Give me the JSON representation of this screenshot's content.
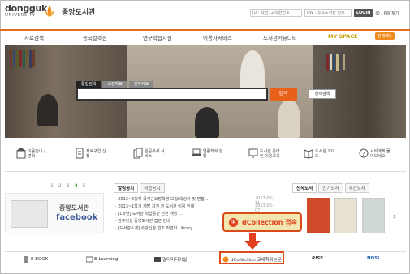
{
  "logo": {
    "name": "dongguk",
    "sub": "UNIVERSITY",
    "library": "중앙도서관"
  },
  "login": {
    "id_placeholder": "ID : 학번, 교직원번호",
    "pw_placeholder": "PW : 소속도서관 번호",
    "login_label": "LOGIN",
    "find_label": "ID / PW 찾기"
  },
  "nav": {
    "items": [
      "자료검색",
      "동국컬렉션",
      "연구학습지원",
      "이용자서비스",
      "도서관커뮤니티",
      "MY SPACE"
    ],
    "all_menu": "전체메뉴"
  },
  "search": {
    "tabs": [
      "통합검색",
      "소장자료",
      "전자자료"
    ],
    "search_label": "검색",
    "advanced_label": "상세검색"
  },
  "quick": [
    {
      "label": "이용안내 / 면회"
    },
    {
      "label": "자료구입 신청"
    },
    {
      "label": "원문복사 서비스"
    },
    {
      "label": "열람좌석 현황"
    },
    {
      "label": "도서관 온라인 이용교육"
    },
    {
      "label": "도서관 가이드"
    },
    {
      "label": "시비에게 물어보세요"
    }
  ],
  "pager": {
    "pages": [
      "1",
      "2",
      "3",
      "4",
      "5"
    ],
    "current": "4"
  },
  "facebook": {
    "t1": "중앙도서관",
    "t2": "facebook"
  },
  "notice": {
    "tabs": [
      "알림공지",
      "학습공지"
    ],
    "rows": [
      {
        "title": "· 2013~6월체 국가근로장학생 모집(대상자 및 면접...",
        "date": "2013-06-11"
      },
      {
        "title": "· 2013~1학기 개방 자가 권 도서관 이용 안내",
        "date": "2013-06-07"
      },
      {
        "title": "· [1학년] 도서관 학습공간 전원 개방 ...",
        "date": ""
      },
      {
        "title": "· 컴퓨터실 중앙도서관 접근 안내",
        "date": ""
      },
      {
        "title": "· [도서관소개] 수강신청 협조 마련다 Library",
        "date": ""
      }
    ]
  },
  "books": {
    "tabs": [
      "신작도서",
      "인기도서",
      "추천도서"
    ]
  },
  "callout": {
    "number": "①",
    "text": "dCollection 접속"
  },
  "links": [
    "E-BOOK",
    "E-Learning",
    "멀티미디어실",
    "dCollection 교내학위논문",
    "RISS",
    "NDSL"
  ],
  "colors": {
    "accent": "#e36b1b",
    "callout_border": "#d94b1a",
    "callout_bg": "#f1e6b0",
    "facebook": "#3b5998"
  }
}
